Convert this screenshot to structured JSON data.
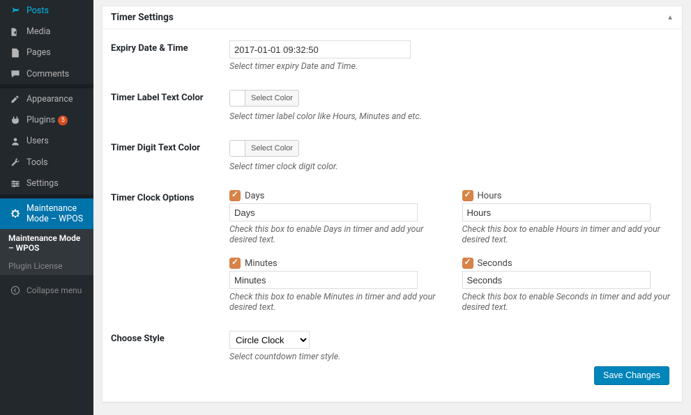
{
  "sidebar": {
    "items": [
      {
        "label": "Posts",
        "icon": "pin"
      },
      {
        "label": "Media",
        "icon": "media"
      },
      {
        "label": "Pages",
        "icon": "page"
      },
      {
        "label": "Comments",
        "icon": "comment"
      },
      {
        "label": "Appearance",
        "icon": "appearance"
      },
      {
        "label": "Plugins",
        "icon": "plugin",
        "badge": "5"
      },
      {
        "label": "Users",
        "icon": "users"
      },
      {
        "label": "Tools",
        "icon": "tools"
      },
      {
        "label": "Settings",
        "icon": "settings"
      },
      {
        "label": "Maintenance Mode – WPOS",
        "icon": "settings",
        "current": true
      }
    ],
    "submenu": [
      {
        "label": "Maintenance Mode – WPOS",
        "current": true
      },
      {
        "label": "Plugin License",
        "current": false
      }
    ],
    "collapse_label": "Collapse menu"
  },
  "panel": {
    "title": "Timer Settings"
  },
  "fields": {
    "expiry": {
      "label": "Expiry Date & Time",
      "value": "2017-01-01 09:32:50",
      "description": "Select timer expiry Date and Time."
    },
    "label_color": {
      "label": "Timer Label Text Color",
      "button_text": "Select Color",
      "description": "Select timer label color like Hours, Minutes and etc."
    },
    "digit_color": {
      "label": "Timer Digit Text Color",
      "button_text": "Select Color",
      "description": "Select timer clock digit color."
    },
    "clock_options": {
      "label": "Timer Clock Options",
      "days": {
        "check_label": "Days",
        "value": "Days",
        "description": "Check this box to enable Days in timer and add your desired text."
      },
      "hours": {
        "check_label": "Hours",
        "value": "Hours",
        "description": "Check this box to enable Hours in timer and add your desired text."
      },
      "minutes": {
        "check_label": "Minutes",
        "value": "Minutes",
        "description": "Check this box to enable Minutes in timer and add your desired text."
      },
      "seconds": {
        "check_label": "Seconds",
        "value": "Seconds",
        "description": "Check this box to enable Seconds in timer and add your desired text."
      }
    },
    "style": {
      "label": "Choose Style",
      "value": "Circle Clock",
      "description": "Select countdown timer style."
    }
  },
  "save_button": "Save Changes"
}
